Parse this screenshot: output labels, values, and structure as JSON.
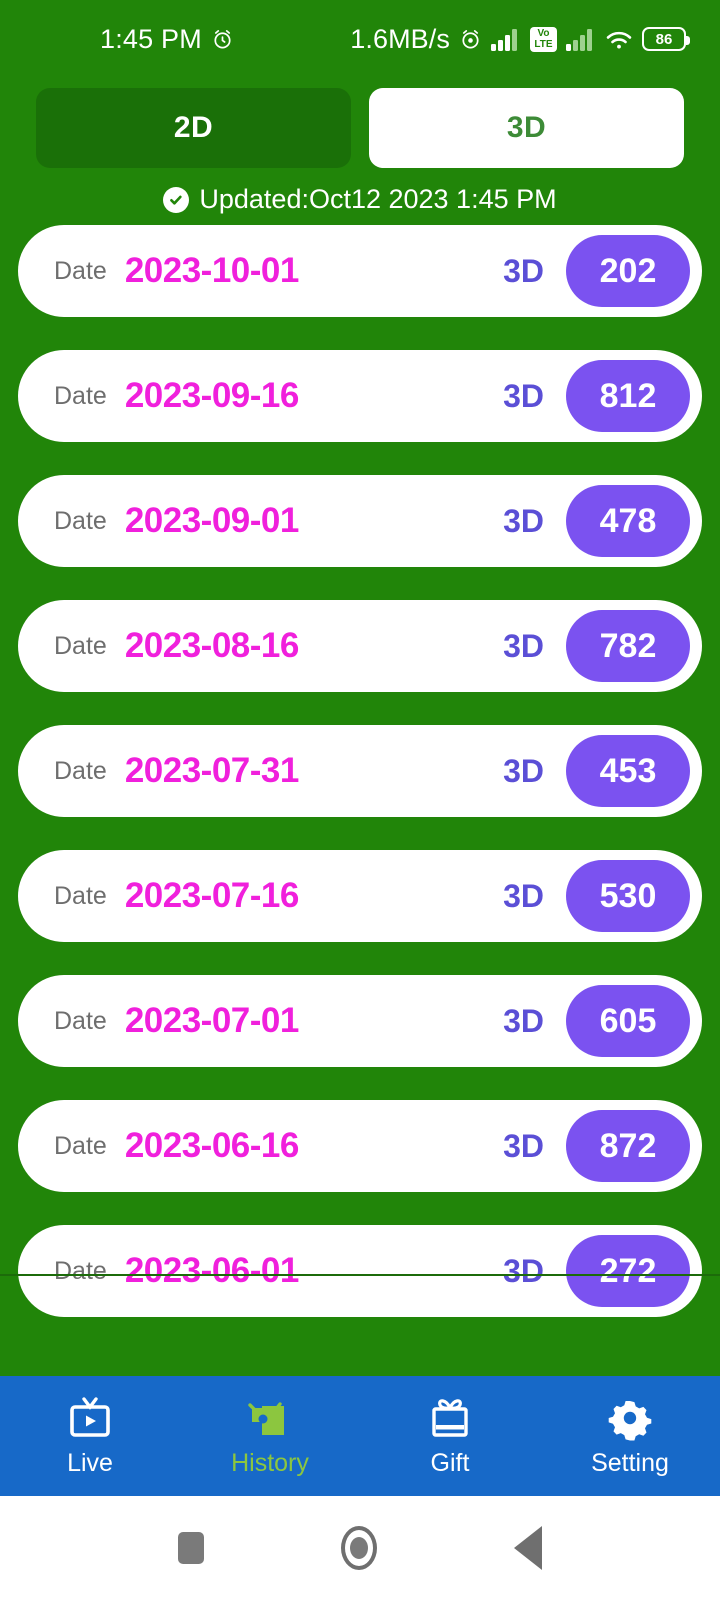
{
  "status_bar": {
    "time": "1:45 PM",
    "alarm_icon": "alarm-clock-icon",
    "network_speed": "1.6MB/s",
    "alarm_icon_right": "alarm-clock-icon",
    "signal_1_icon": "signal-bars-icon",
    "volte_line1": "Vo",
    "volte_line2": "LTE",
    "signal_2_icon": "signal-bars-icon",
    "wifi_icon": "wifi-icon",
    "battery_level": "86"
  },
  "tabs": [
    {
      "label": "2D",
      "active": false
    },
    {
      "label": "3D",
      "active": true
    }
  ],
  "updated": {
    "icon": "check-circle-icon",
    "text": "Updated:Oct12 2023 1:45 PM"
  },
  "list": {
    "date_label": "Date",
    "type_label": "3D",
    "rows": [
      {
        "date_label": "Date",
        "date": "2023-10-01",
        "type": "3D",
        "value": "202"
      },
      {
        "date_label": "Date",
        "date": "2023-09-16",
        "type": "3D",
        "value": "812"
      },
      {
        "date_label": "Date",
        "date": "2023-09-01",
        "type": "3D",
        "value": "478"
      },
      {
        "date_label": "Date",
        "date": "2023-08-16",
        "type": "3D",
        "value": "782"
      },
      {
        "date_label": "Date",
        "date": "2023-07-31",
        "type": "3D",
        "value": "453"
      },
      {
        "date_label": "Date",
        "date": "2023-07-16",
        "type": "3D",
        "value": "530"
      },
      {
        "date_label": "Date",
        "date": "2023-07-01",
        "type": "3D",
        "value": "605"
      },
      {
        "date_label": "Date",
        "date": "2023-06-16",
        "type": "3D",
        "value": "872"
      },
      {
        "date_label": "Date",
        "date": "2023-06-01",
        "type": "3D",
        "value": "272"
      }
    ]
  },
  "bottom_nav": [
    {
      "label": "Live",
      "icon": "tv-play-icon",
      "active": false
    },
    {
      "label": "History",
      "icon": "history-icon",
      "active": true
    },
    {
      "label": "Gift",
      "icon": "gift-box-icon",
      "active": false
    },
    {
      "label": "Setting",
      "icon": "gear-icon",
      "active": false
    }
  ],
  "system_nav": [
    {
      "name": "recents-button"
    },
    {
      "name": "home-button"
    },
    {
      "name": "back-button"
    }
  ],
  "colors": {
    "brand_green": "#218509",
    "tab_inactive_green": "#1a7008",
    "tab_active_text": "#3d8b37",
    "date_magenta": "#f020dc",
    "type_violet": "#5b4fd6",
    "badge_purple": "#7b52f0",
    "nav_blue": "#1769c8",
    "nav_active_green": "#8cc63f"
  }
}
